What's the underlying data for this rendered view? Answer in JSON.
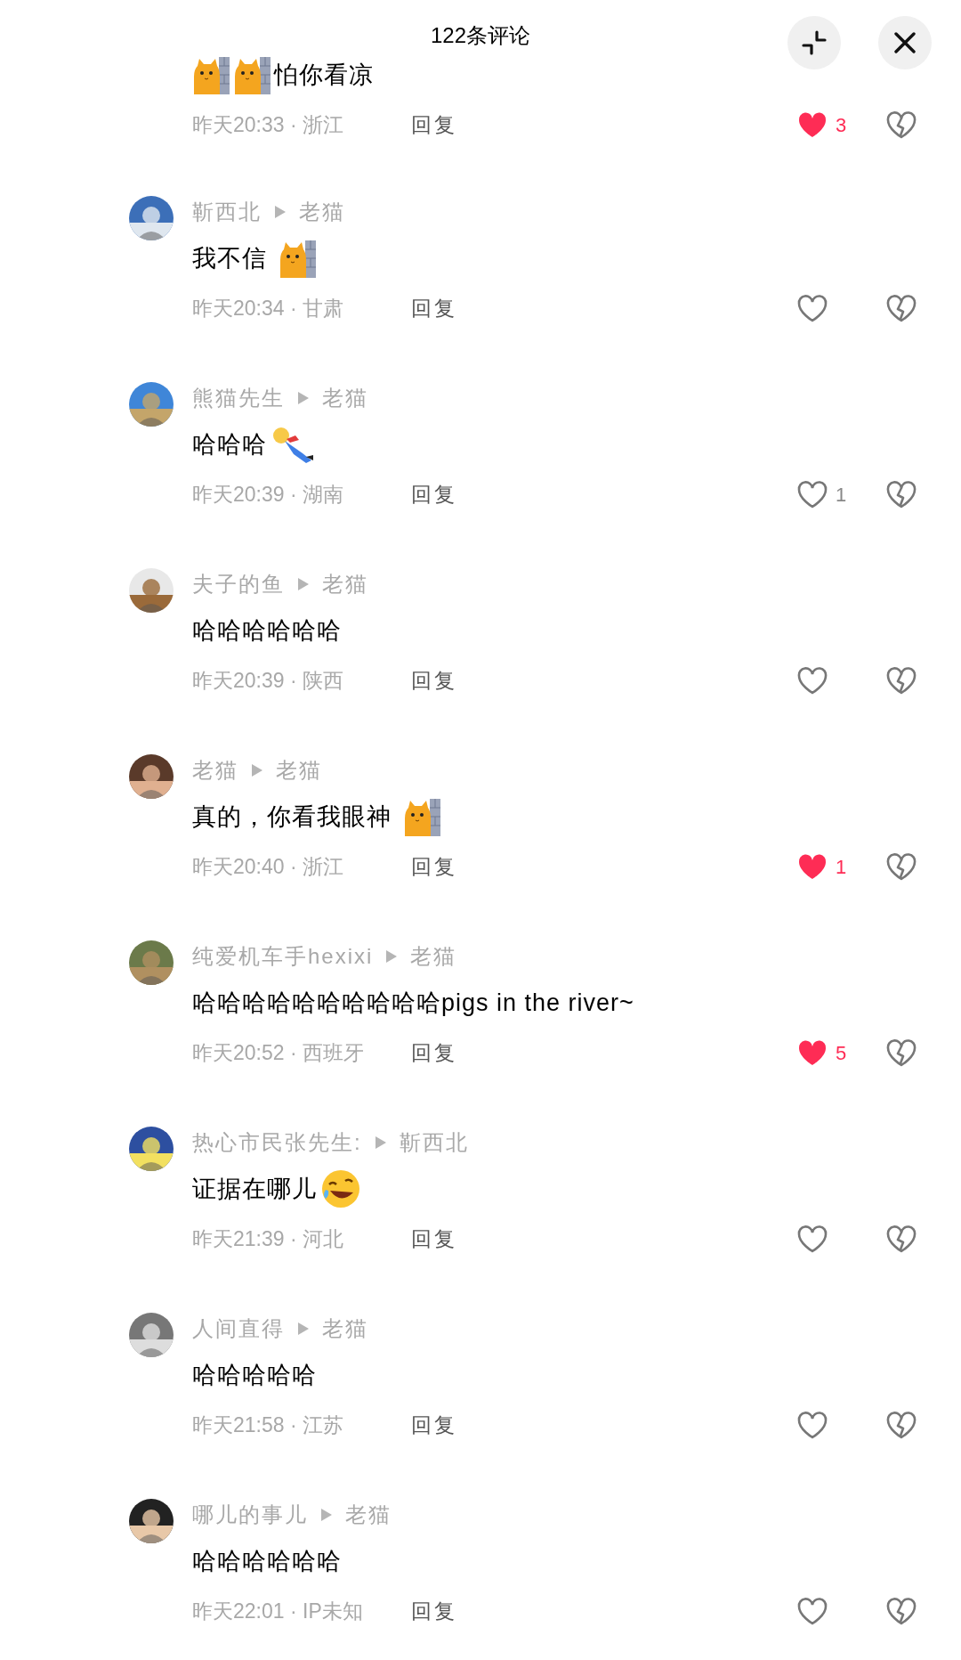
{
  "header": {
    "title": "122条评论"
  },
  "comments": [
    {
      "content": [
        {
          "kind": "cat_sticker"
        },
        {
          "kind": "cat_sticker"
        },
        {
          "kind": "text",
          "text": "怕你看凉"
        }
      ],
      "time": "昨天20:33 · 浙江",
      "reply": "回复",
      "liked": true,
      "likes": "3"
    },
    {
      "author": "靳西北",
      "reply_to": "老猫",
      "content": [
        {
          "kind": "text",
          "text": "我不信 "
        },
        {
          "kind": "cat_sticker"
        }
      ],
      "time": "昨天20:34 · 甘肃",
      "reply": "回复",
      "liked": false
    },
    {
      "author": "熊猫先生",
      "reply_to": "老猫",
      "content": [
        {
          "kind": "text",
          "text": "哈哈哈"
        },
        {
          "kind": "fallen_sticker"
        }
      ],
      "time": "昨天20:39 · 湖南",
      "reply": "回复",
      "liked": false,
      "likes": "1"
    },
    {
      "author": "夫子的鱼",
      "reply_to": "老猫",
      "content": [
        {
          "kind": "text",
          "text": "哈哈哈哈哈哈"
        }
      ],
      "time": "昨天20:39 · 陕西",
      "reply": "回复",
      "liked": false
    },
    {
      "author": "老猫",
      "reply_to": "老猫",
      "content": [
        {
          "kind": "text",
          "text": "真的，你看我眼神 "
        },
        {
          "kind": "cat_sticker"
        }
      ],
      "time": "昨天20:40 · 浙江",
      "reply": "回复",
      "liked": true,
      "likes": "1"
    },
    {
      "author": "纯爱机车手hexixi",
      "reply_to": "老猫",
      "content": [
        {
          "kind": "text",
          "text": "哈哈哈哈哈哈哈哈哈哈pigs in the river~"
        }
      ],
      "time": "昨天20:52 · 西班牙",
      "reply": "回复",
      "liked": true,
      "likes": "5"
    },
    {
      "author": "热心市民张先生:",
      "reply_to": "靳西北",
      "content": [
        {
          "kind": "text",
          "text": "证据在哪儿"
        },
        {
          "kind": "laugh_emoji"
        }
      ],
      "time": "昨天21:39 · 河北",
      "reply": "回复",
      "liked": false
    },
    {
      "author": "人间直得",
      "reply_to": "老猫",
      "content": [
        {
          "kind": "text",
          "text": "哈哈哈哈哈"
        }
      ],
      "time": "昨天21:58 · 江苏",
      "reply": "回复",
      "liked": false
    },
    {
      "author": "哪儿的事儿",
      "reply_to": "老猫",
      "content": [
        {
          "kind": "text",
          "text": "哈哈哈哈哈哈"
        }
      ],
      "time": "昨天22:01 · IP未知",
      "reply": "回复",
      "liked": false
    }
  ]
}
